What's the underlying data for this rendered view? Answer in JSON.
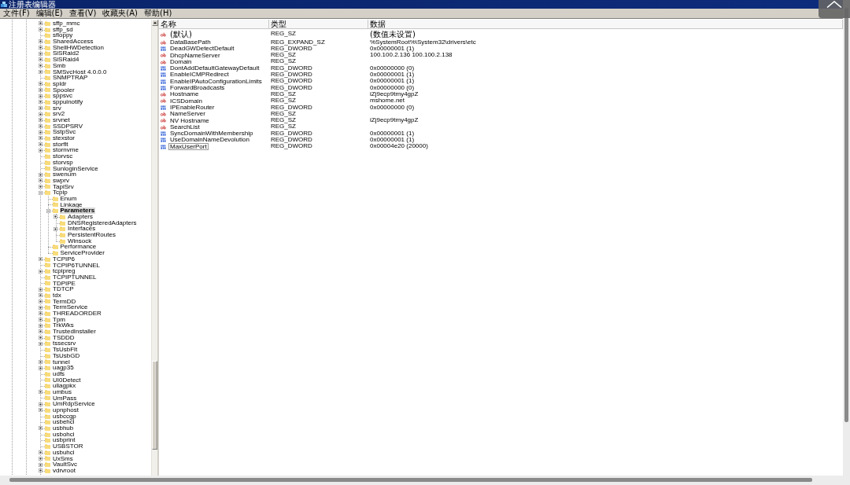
{
  "window": {
    "title": "注册表编辑器"
  },
  "menu": [
    "文件(F)",
    "编辑(E)",
    "查看(V)",
    "收藏夹(A)",
    "帮助(H)"
  ],
  "tree": [
    {
      "label": "sffp_mmc",
      "expanded": false,
      "selected": false
    },
    {
      "label": "sffp_sd",
      "expanded": false,
      "selected": false
    },
    {
      "label": "sfloppy",
      "selected": false
    },
    {
      "label": "SharedAccess",
      "expanded": false,
      "selected": false
    },
    {
      "label": "ShellHWDetection",
      "expanded": false,
      "selected": false
    },
    {
      "label": "SiSRaid2",
      "expanded": false,
      "selected": false
    },
    {
      "label": "SiSRaid4",
      "expanded": false,
      "selected": false
    },
    {
      "label": "Smb",
      "expanded": false,
      "selected": false
    },
    {
      "label": "SMSvcHost 4.0.0.0",
      "expanded": false,
      "selected": false
    },
    {
      "label": "SNMPTRAP",
      "selected": false
    },
    {
      "label": "spldr",
      "expanded": false,
      "selected": false
    },
    {
      "label": "Spooler",
      "expanded": false,
      "selected": false
    },
    {
      "label": "sppsvc",
      "expanded": false,
      "selected": false
    },
    {
      "label": "sppuinotify",
      "expanded": false,
      "selected": false
    },
    {
      "label": "srv",
      "expanded": false,
      "selected": false
    },
    {
      "label": "srv2",
      "expanded": false,
      "selected": false
    },
    {
      "label": "srvnet",
      "expanded": false,
      "selected": false
    },
    {
      "label": "SSDPSRV",
      "expanded": false,
      "selected": false
    },
    {
      "label": "SstpSvc",
      "expanded": false,
      "selected": false
    },
    {
      "label": "stexstor",
      "expanded": false,
      "selected": false
    },
    {
      "label": "storflt",
      "expanded": false,
      "selected": false
    },
    {
      "label": "stornvme",
      "expanded": false,
      "selected": false
    },
    {
      "label": "storvsc",
      "selected": false
    },
    {
      "label": "storvsp",
      "selected": false
    },
    {
      "label": "SunloginService",
      "selected": false
    },
    {
      "label": "swenum",
      "expanded": false,
      "selected": false
    },
    {
      "label": "swprv",
      "expanded": false,
      "selected": false
    },
    {
      "label": "TapiSrv",
      "expanded": false,
      "selected": false
    },
    {
      "label": "Tcpip",
      "expanded": true,
      "selected": false,
      "children": [
        {
          "label": "Enum",
          "selected": false
        },
        {
          "label": "Linkage",
          "selected": false
        },
        {
          "label": "Parameters",
          "expanded": true,
          "selected": true,
          "children": [
            {
              "label": "Adapters",
              "expanded": false,
              "selected": false
            },
            {
              "label": "DNSRegisteredAdapters",
              "selected": false
            },
            {
              "label": "Interfaces",
              "expanded": false,
              "selected": false
            },
            {
              "label": "PersistentRoutes",
              "selected": false
            },
            {
              "label": "Winsock",
              "selected": false
            }
          ]
        },
        {
          "label": "Performance",
          "selected": false
        },
        {
          "label": "ServiceProvider",
          "selected": false
        }
      ]
    },
    {
      "label": "TCPIP6",
      "expanded": false,
      "selected": false
    },
    {
      "label": "TCPIP6TUNNEL",
      "selected": false
    },
    {
      "label": "tcpipreg",
      "expanded": false,
      "selected": false
    },
    {
      "label": "TCPIPTUNNEL",
      "selected": false
    },
    {
      "label": "TDPIPE",
      "selected": false
    },
    {
      "label": "TDTCP",
      "expanded": false,
      "selected": false
    },
    {
      "label": "tdx",
      "expanded": false,
      "selected": false
    },
    {
      "label": "TermDD",
      "expanded": false,
      "selected": false
    },
    {
      "label": "TermService",
      "expanded": false,
      "selected": false
    },
    {
      "label": "THREADORDER",
      "expanded": false,
      "selected": false
    },
    {
      "label": "Tpm",
      "expanded": false,
      "selected": false
    },
    {
      "label": "TrkWks",
      "expanded": false,
      "selected": false
    },
    {
      "label": "TrustedInstaller",
      "expanded": false,
      "selected": false
    },
    {
      "label": "TSDDD",
      "expanded": false,
      "selected": false
    },
    {
      "label": "tssecsrv",
      "expanded": false,
      "selected": false
    },
    {
      "label": "TsUsbFlt",
      "selected": false
    },
    {
      "label": "TsUsbGD",
      "selected": false
    },
    {
      "label": "tunnel",
      "expanded": false,
      "selected": false
    },
    {
      "label": "uagp35",
      "expanded": false,
      "selected": false
    },
    {
      "label": "udfs",
      "selected": false
    },
    {
      "label": "UI0Detect",
      "selected": false
    },
    {
      "label": "uliagpkx",
      "selected": false
    },
    {
      "label": "umbus",
      "expanded": false,
      "selected": false
    },
    {
      "label": "UmPass",
      "selected": false
    },
    {
      "label": "UmRdpService",
      "expanded": false,
      "selected": false
    },
    {
      "label": "upnphost",
      "expanded": false,
      "selected": false
    },
    {
      "label": "usbccgp",
      "selected": false
    },
    {
      "label": "usbehci",
      "selected": false
    },
    {
      "label": "usbhub",
      "expanded": false,
      "selected": false
    },
    {
      "label": "usbohci",
      "selected": false
    },
    {
      "label": "usbprint",
      "selected": false
    },
    {
      "label": "USBSTOR",
      "selected": false
    },
    {
      "label": "usbuhci",
      "expanded": false,
      "selected": false
    },
    {
      "label": "UxSms",
      "expanded": false,
      "selected": false
    },
    {
      "label": "VaultSvc",
      "expanded": false,
      "selected": false
    },
    {
      "label": "vdrvroot",
      "expanded": false,
      "selected": false
    }
  ],
  "values": {
    "columns": [
      "名称",
      "类型",
      "数据"
    ],
    "rows": [
      {
        "kind": "default",
        "name": "(默认)",
        "type": "REG_SZ",
        "data": "(数值未设置)",
        "selected": false
      },
      {
        "kind": "string",
        "name": "DataBasePath",
        "type": "REG_EXPAND_SZ",
        "data": "%SystemRoot%\\System32\\drivers\\etc",
        "selected": false
      },
      {
        "kind": "binary",
        "name": "DeadGWDetectDefault",
        "type": "REG_DWORD",
        "data": "0x00000001 (1)",
        "selected": false
      },
      {
        "kind": "string",
        "name": "DhcpNameServer",
        "type": "REG_SZ",
        "data": "100.100.2.136 100.100.2.138",
        "selected": false
      },
      {
        "kind": "string",
        "name": "Domain",
        "type": "REG_SZ",
        "selected": false
      },
      {
        "kind": "binary",
        "name": "DontAddDefaultGatewayDefault",
        "type": "REG_DWORD",
        "data": "0x00000000 (0)",
        "selected": false
      },
      {
        "kind": "binary",
        "name": "EnableICMPRedirect",
        "type": "REG_DWORD",
        "data": "0x00000001 (1)",
        "selected": false
      },
      {
        "kind": "binary",
        "name": "EnableIPAutoConfigurationLimits",
        "type": "REG_DWORD",
        "data": "0x00000001 (1)",
        "selected": false
      },
      {
        "kind": "binary",
        "name": "ForwardBroadcasts",
        "type": "REG_DWORD",
        "data": "0x00000000 (0)",
        "selected": false
      },
      {
        "kind": "string",
        "name": "Hostname",
        "type": "REG_SZ",
        "data": "iZj9ecp9tmy4gpZ",
        "selected": false
      },
      {
        "kind": "string",
        "name": "ICSDomain",
        "type": "REG_SZ",
        "data": "mshome.net",
        "selected": false
      },
      {
        "kind": "binary",
        "name": "IPEnableRouter",
        "type": "REG_DWORD",
        "data": "0x00000000 (0)",
        "selected": false
      },
      {
        "kind": "string",
        "name": "NameServer",
        "type": "REG_SZ",
        "selected": false
      },
      {
        "kind": "string",
        "name": "NV Hostname",
        "type": "REG_SZ",
        "data": "iZj9ecp9tmy4gpZ",
        "selected": false
      },
      {
        "kind": "string",
        "name": "SearchList",
        "type": "REG_SZ",
        "selected": false
      },
      {
        "kind": "binary",
        "name": "SyncDomainWithMembership",
        "type": "REG_DWORD",
        "data": "0x00000001 (1)",
        "selected": false
      },
      {
        "kind": "binary",
        "name": "UseDomainNameDevolution",
        "type": "REG_DWORD",
        "data": "0x00000001 (1)",
        "selected": false
      },
      {
        "kind": "binary",
        "name": "MaxUserPort",
        "type": "REG_DWORD",
        "data": "0x00004e20 (20000)",
        "selected": true
      }
    ]
  }
}
